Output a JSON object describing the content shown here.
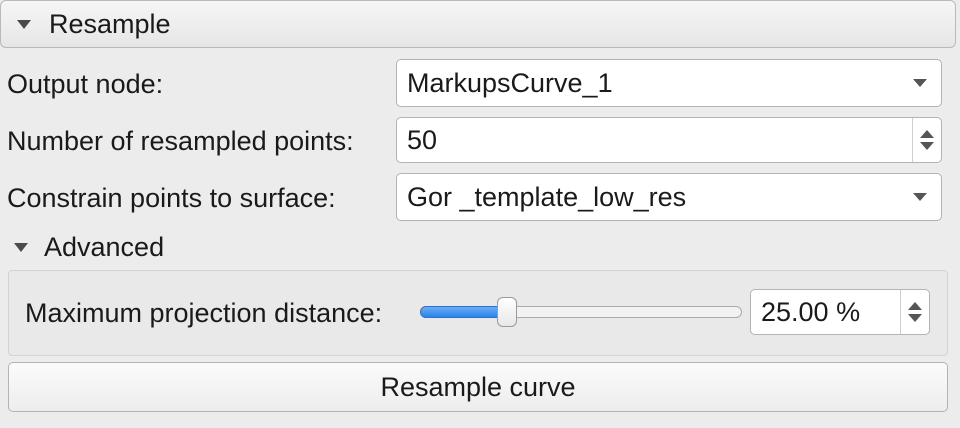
{
  "section": {
    "title": "Resample"
  },
  "form": {
    "output_node": {
      "label": "Output node:",
      "value": "MarkupsCurve_1"
    },
    "num_points": {
      "label": "Number of resampled points:",
      "value": "50"
    },
    "constrain_surface": {
      "label": "Constrain points to surface:",
      "value": "Gor _template_low_res"
    }
  },
  "advanced": {
    "title": "Advanced",
    "max_projection": {
      "label": "Maximum projection distance:",
      "value_text": "25.00 %",
      "fraction": 0.27
    }
  },
  "actions": {
    "resample_label": "Resample curve"
  },
  "colors": {
    "slider_fill": "#3a8ef0"
  }
}
